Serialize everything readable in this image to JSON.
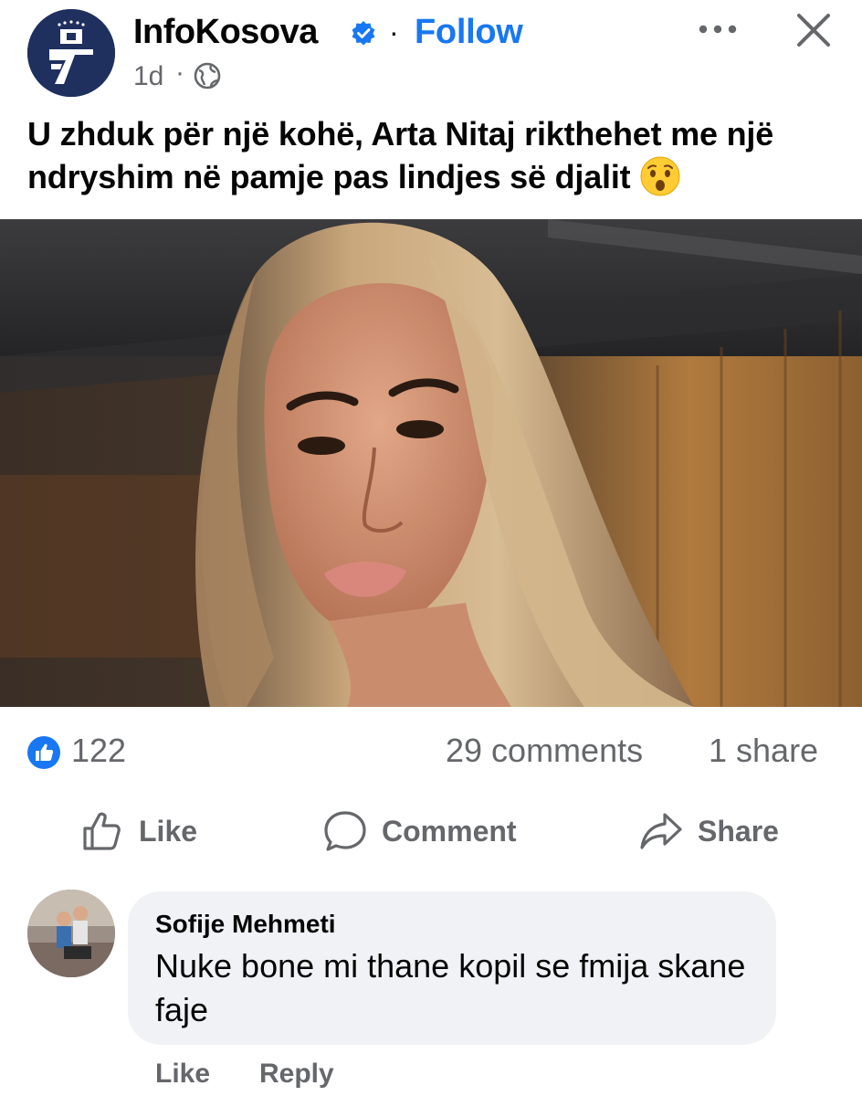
{
  "post": {
    "page_name": "InfoKosova",
    "follow_separator": "·",
    "follow_label": "Follow",
    "time": "1d",
    "time_separator": "·",
    "privacy_icon": "globe-icon",
    "caption": "U zhduk për një kohë, Arta Nitaj rikthehet me një ndryshim në pamje pas lindjes së djalit",
    "caption_emoji": "astonished-face-emoji"
  },
  "stats": {
    "likes": "122",
    "comments": "29 comments",
    "shares": "1 share"
  },
  "actions": {
    "like": "Like",
    "comment": "Comment",
    "share": "Share"
  },
  "comment": {
    "author": "Sofije Mehmeti",
    "text": "Nuke bone mi thane kopil se fmija skane faje",
    "like_label": "Like",
    "reply_label": "Reply"
  },
  "colors": {
    "accent": "#1877f2",
    "secondary_text": "#65676b",
    "bubble": "#f0f2f5",
    "avatar_bg": "#1f2f5e"
  }
}
